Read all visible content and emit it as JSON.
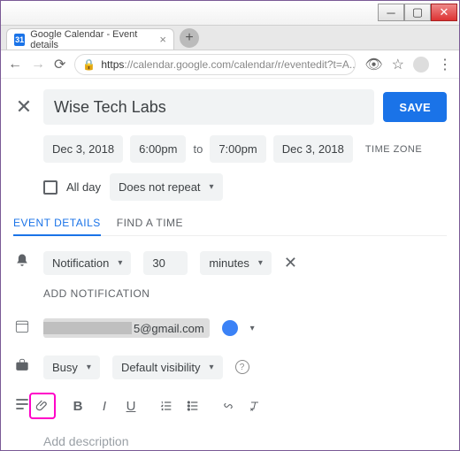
{
  "window": {
    "tab_title": "Google Calendar - Event details",
    "favicon_text": "31",
    "url_secure_prefix": "https",
    "url_host": "://calendar.google.com",
    "url_path": "/calendar/r/eventedit?t=A..."
  },
  "header": {
    "title_value": "Wise Tech Labs",
    "save_label": "SAVE"
  },
  "datetime": {
    "start_date": "Dec 3, 2018",
    "start_time": "6:00pm",
    "to_label": "to",
    "end_time": "7:00pm",
    "end_date": "Dec 3, 2018",
    "timezone_label": "TIME ZONE"
  },
  "options": {
    "all_day_label": "All day",
    "repeat_label": "Does not repeat"
  },
  "tabs": {
    "event_details": "EVENT DETAILS",
    "find_time": "FIND A TIME"
  },
  "notification": {
    "type": "Notification",
    "value": "30",
    "unit": "minutes",
    "add_label": "ADD NOTIFICATION"
  },
  "calendar": {
    "email_suffix": "5@gmail.com"
  },
  "availability": {
    "busy": "Busy",
    "visibility": "Default visibility"
  },
  "description": {
    "placeholder": "Add description"
  }
}
